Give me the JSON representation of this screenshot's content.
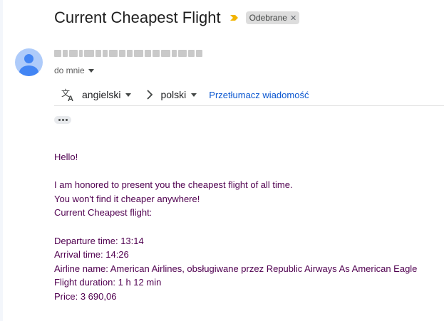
{
  "email": {
    "subject": "Current Cheapest Flight",
    "label": "Odebrane",
    "to": "do mnie"
  },
  "translate": {
    "from_lang": "angielski",
    "to_lang": "polski",
    "action": "Przetłumacz wiadomość"
  },
  "message": {
    "greeting": "Hello!",
    "line1": "I am honored to present you the cheapest flight of all time.",
    "line2": "You won't find it cheaper anywhere!",
    "line3": "Current Cheapest flight:",
    "departure": "Departure time: 13:14",
    "arrival": "Arrival time: 14:26",
    "airline": "Airline name: American Airlines, obsługiwane przez Republic Airways As American Eagle",
    "duration": "Flight duration: 1 h 12 min",
    "price": "Price: 3 690,06"
  },
  "icons": {
    "importance": "importance-marker-icon",
    "translate": "translate-icon",
    "arrow": "chevron-right-icon",
    "more": "more-horiz-icon"
  },
  "colors": {
    "importance": "#f2b400",
    "link": "#0b57d0",
    "body_text": "#500050",
    "chip_bg": "#dddddd",
    "avatar_bg": "#aecbfa",
    "avatar_fg": "#4285f4"
  }
}
